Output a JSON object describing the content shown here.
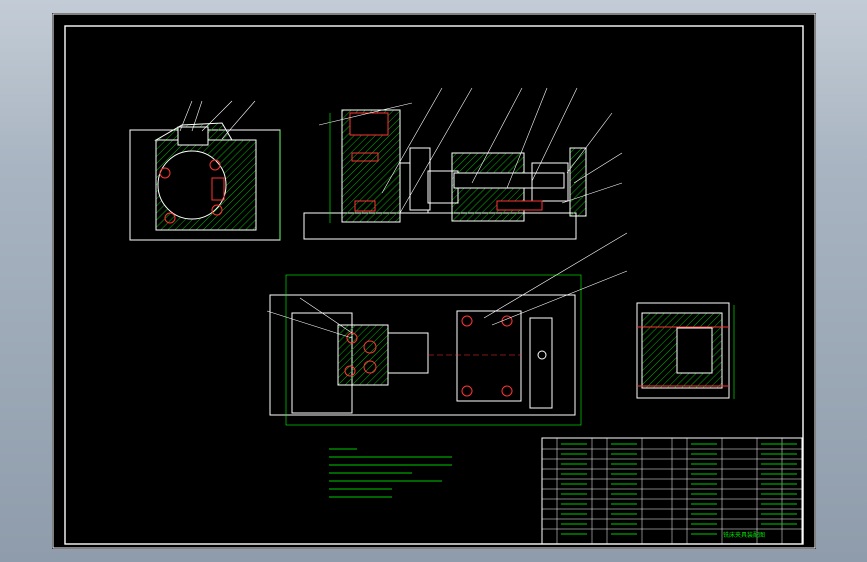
{
  "title_block": {
    "drawing_title": "铣床夹具装配图"
  },
  "colors": {
    "background": "#000000",
    "outline": "#ffffff",
    "hatch": "#00c800",
    "part": "#ff3333",
    "dim": "#00ff00",
    "leader": "#ffffff"
  },
  "icons": [
    "fixture-assembly-drawing"
  ]
}
